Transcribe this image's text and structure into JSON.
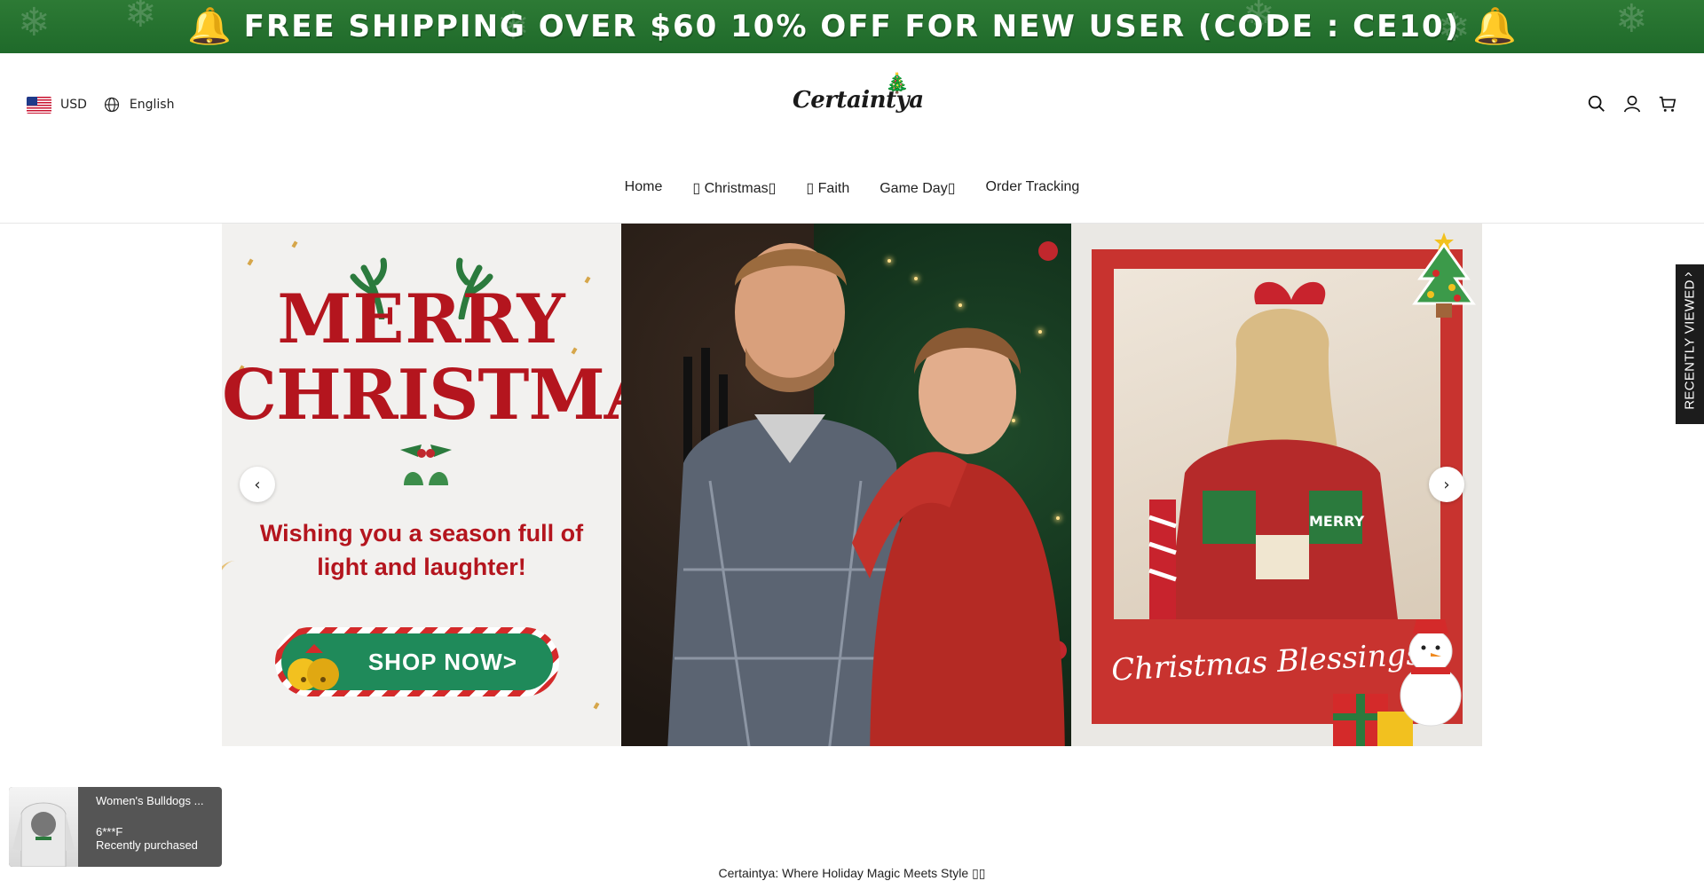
{
  "promo": {
    "text": "FREE SHIPPING OVER $60   10% OFF FOR NEW USER (CODE : CE10)",
    "background": "#2d7a35",
    "icons": [
      "bell-icon",
      "bell-icon"
    ]
  },
  "header": {
    "currency": "USD",
    "language": "English",
    "logo_text": "Certaintya",
    "icons": [
      "search-icon",
      "account-icon",
      "cart-icon"
    ]
  },
  "nav": {
    "items": [
      {
        "label": "Home"
      },
      {
        "label": "▯ Christmas▯"
      },
      {
        "label": "▯ Faith"
      },
      {
        "label": "Game Day▯"
      },
      {
        "label": "Order Tracking"
      }
    ]
  },
  "hero": {
    "left": {
      "line1": "MERRY",
      "line2": "CHRISTMAS",
      "wish": "Wishing you a season full of light and laughter!",
      "button": "SHOP NOW>"
    },
    "right": {
      "caption": "Christmas Blessings",
      "sweater_text": "MERRY"
    },
    "prev_label": "‹",
    "next_label": "›",
    "accent_red": "#b4151e",
    "accent_green": "#1f8a5a"
  },
  "recently_viewed": {
    "label": "RECENTLY VIEWED",
    "chevron": "^"
  },
  "toast": {
    "title": "Women's Bulldogs ...",
    "user": "6***F",
    "status": "Recently purchased"
  },
  "tagline": "Certaintya: Where Holiday Magic Meets Style ▯▯"
}
